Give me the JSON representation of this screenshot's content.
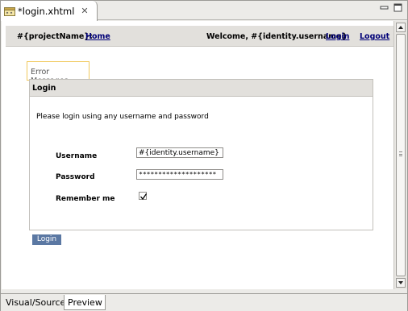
{
  "tab": {
    "title": "*login.xhtml",
    "icon": "xhtml-file-icon"
  },
  "window_controls": {
    "minimize_icon": "minimize-icon",
    "maximize_icon": "maximize-icon"
  },
  "header": {
    "project_name": "#{projectName}:",
    "home_link": "Home",
    "welcome": "Welcome, #{identity.username}",
    "login_link": "Login",
    "logout_link": "Logout"
  },
  "error_tab": "Error Messages",
  "panel": {
    "title": "Login",
    "intro": "Please login using any username and password",
    "username_label": "Username",
    "username_value": "#{identity.username}",
    "password_label": "Password",
    "password_value": "********************",
    "remember_label": "Remember me",
    "remember_checked": true
  },
  "login_button": "Login",
  "bottom_tabs": [
    {
      "label": "Visual/Source",
      "active": false
    },
    {
      "label": "Preview",
      "active": true
    }
  ],
  "colors": {
    "link": "#000077",
    "button": "#5b78a3",
    "focus_border": "#f1c95d"
  }
}
